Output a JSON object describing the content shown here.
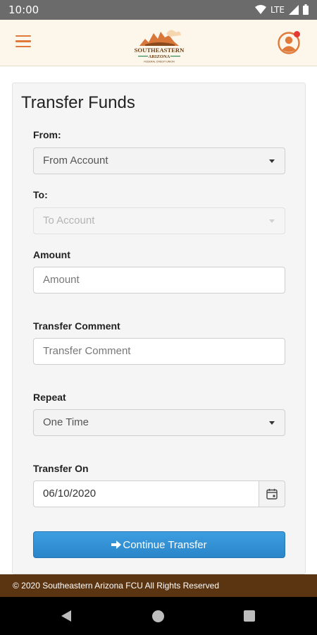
{
  "status_bar": {
    "time": "10:00",
    "network": "LTE"
  },
  "header": {
    "logo_line1": "SOUTHEASTERN",
    "logo_line2": "ARIZONA",
    "logo_line3": "FEDERAL CREDIT UNION"
  },
  "page": {
    "title": "Transfer Funds"
  },
  "form": {
    "from_label": "From:",
    "from_value": "From Account",
    "to_label": "To:",
    "to_value": "To Account",
    "amount_label": "Amount",
    "amount_placeholder": "Amount",
    "comment_label": "Transfer Comment",
    "comment_placeholder": "Transfer Comment",
    "repeat_label": "Repeat",
    "repeat_value": "One Time",
    "transfer_on_label": "Transfer On",
    "transfer_on_value": "06/10/2020",
    "continue_label": "Continue Transfer"
  },
  "footer": {
    "copyright": "© 2020 Southeastern Arizona FCU All Rights Reserved"
  },
  "colors": {
    "accent": "#e07a3a",
    "button": "#3d9ee0",
    "footer": "#5b3512",
    "notification": "#e53935"
  }
}
